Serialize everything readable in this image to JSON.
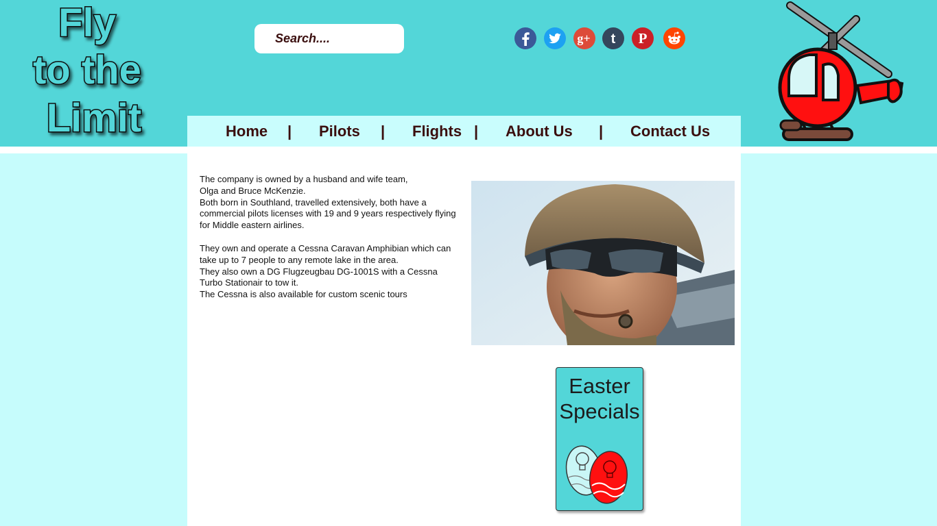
{
  "logo": {
    "line1": "Fly",
    "line2": "to the",
    "line3": "Limit"
  },
  "search": {
    "placeholder": "Search...."
  },
  "social": [
    {
      "icon": "facebook-icon",
      "glyph": "f",
      "color": "#3b5998"
    },
    {
      "icon": "twitter-icon",
      "glyph": "t",
      "color": "#1da1f2"
    },
    {
      "icon": "google-plus-icon",
      "glyph": "g+",
      "color": "#dd4b39"
    },
    {
      "icon": "tumblr-icon",
      "glyph": "t",
      "color": "#35465c"
    },
    {
      "icon": "pinterest-icon",
      "glyph": "P",
      "color": "#cb2027"
    },
    {
      "icon": "reddit-icon",
      "glyph": "r",
      "color": "#ff4500"
    }
  ],
  "nav": {
    "home": "Home",
    "pilots": "Pilots",
    "flights": "Flights",
    "about": "About Us",
    "contact": "Contact Us",
    "separator": "|"
  },
  "content": {
    "paragraph1": "The company is owned by a husband and wife team,\nOlga and Bruce McKenzie.\nBoth born in Southland, travelled extensively, both have a commercial pilots licenses with 19 and 9 years respectively flying for Middle eastern airlines.",
    "paragraph2": "They own and operate a Cessna Caravan Amphibian which can take up to 7 people to any remote lake in the area.\nThey also own a DG Flugzeugbau DG-1001S with a Cessna Turbo Stationair to tow it.\nThe Cessna is also available for custom scenic tours"
  },
  "promo": {
    "title": "Easter\nSpecials"
  },
  "colors": {
    "header": "#53d6d8",
    "background": "#c6fcfc",
    "nav_text": "#3a0e0e",
    "helicopter": "#ff0000"
  }
}
